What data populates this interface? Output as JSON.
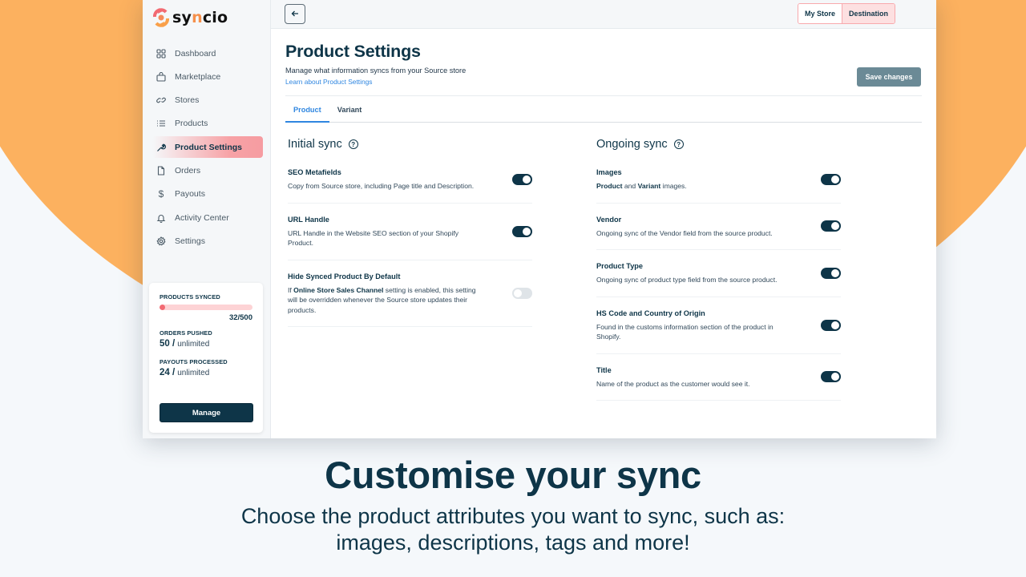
{
  "brand": {
    "name_prefix": "sy",
    "name_mid": "n",
    "name_suffix": "cio",
    "accent": "#f26a72",
    "orange": "#fcb15f",
    "dark": "#0e3548"
  },
  "sidebar": {
    "items": [
      {
        "label": "Dashboard",
        "icon": "grid-icon",
        "active": false
      },
      {
        "label": "Marketplace",
        "icon": "shopping-bag-icon",
        "active": false
      },
      {
        "label": "Stores",
        "icon": "link-icon",
        "active": false
      },
      {
        "label": "Products",
        "icon": "list-icon",
        "active": false
      },
      {
        "label": "Product Settings",
        "icon": "wrench-icon",
        "active": true
      },
      {
        "label": "Orders",
        "icon": "document-icon",
        "active": false
      },
      {
        "label": "Payouts",
        "icon": "dollar-icon",
        "active": false
      },
      {
        "label": "Activity Center",
        "icon": "bell-icon",
        "active": false
      },
      {
        "label": "Settings",
        "icon": "gear-icon",
        "active": false
      }
    ],
    "stats": {
      "products_synced_label": "PRODUCTS SYNCED",
      "products_synced_count": "32/500",
      "products_synced_fraction": 0.064,
      "orders_pushed_label": "ORDERS PUSHED",
      "orders_pushed_value": "50 /",
      "orders_pushed_limit": "unlimited",
      "payouts_label": "PAYOUTS PROCESSED",
      "payouts_value": "24 /",
      "payouts_limit": "unlimited",
      "manage_label": "Manage"
    }
  },
  "topbar": {
    "my_store_label": "My Store",
    "destination_label": "Destination"
  },
  "page": {
    "title": "Product Settings",
    "subtitle": "Manage what information syncs from your Source store",
    "link": "Learn about Product Settings",
    "save_label": "Save changes",
    "tabs": [
      {
        "label": "Product",
        "active": true
      },
      {
        "label": "Variant",
        "active": false
      }
    ]
  },
  "initial_sync": {
    "title": "Initial sync",
    "settings": [
      {
        "name": "SEO Metafields",
        "desc": "Copy from Source store, including Page title and Description.",
        "enabled": true
      },
      {
        "name": "URL Handle",
        "desc": "URL Handle in the Website SEO section of your Shopify Product.",
        "enabled": true
      },
      {
        "name": "Hide Synced Product By Default",
        "desc_bold": "Online Store Sales Channel",
        "desc_pre": "If ",
        "desc_post": " setting is enabled, this setting will be overridden whenever the Source store updates their products.",
        "enabled": false
      }
    ]
  },
  "ongoing_sync": {
    "title": "Ongoing sync",
    "settings": [
      {
        "name": "Images",
        "desc_b1": "Product",
        "desc_mid": " and ",
        "desc_b2": "Variant",
        "desc_end": " images.",
        "enabled": true
      },
      {
        "name": "Vendor",
        "desc": "Ongoing sync of the Vendor field from the source product.",
        "enabled": true
      },
      {
        "name": "Product Type",
        "desc": "Ongoing sync of product type field from the source product.",
        "enabled": true
      },
      {
        "name": "HS Code and Country of Origin",
        "desc": "Found in the customs information section of the product in Shopify.",
        "enabled": true
      },
      {
        "name": "Title",
        "desc": "Name of the product as the customer would see it.",
        "enabled": true
      }
    ]
  },
  "caption": {
    "headline": "Customise your sync",
    "line1": "Choose the product attributes you want to sync, such as:",
    "line2": "images, descriptions, tags and more!"
  }
}
